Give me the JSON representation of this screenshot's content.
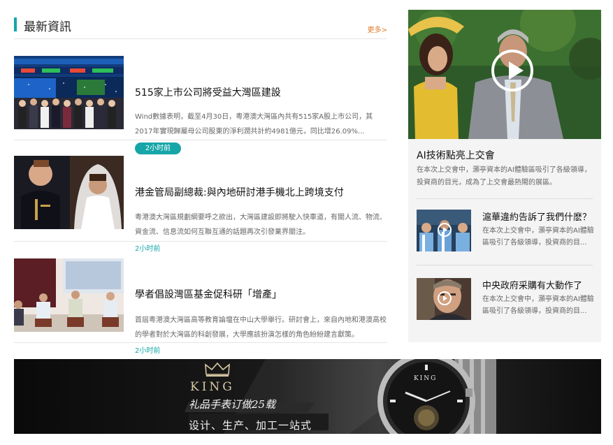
{
  "news": {
    "section_title": "最新資訊",
    "more_link": "更多>",
    "items": [
      {
        "headline": "515家上市公司將受益大灣區建設",
        "summary": "Wind數據表明，截至4月30日，粵港澳大灣區內共有515家A股上市公司，其2017年實現歸屬母公司股東的淨利潤共計約4981億元，同比增26.09%...",
        "time": "2小时前"
      },
      {
        "headline": "港金管局副總裁:與內地研討港手機北上跨境支付",
        "summary": "粵港澳大灣區規劃綱要呼之欲出，大灣區建設即將駛入快車道，有關人流、物流、資金流、信息流如何互聯互通的話題再次引發業界關注。",
        "time": "2小时前"
      },
      {
        "headline": "學者倡設灣區基金促科研「增產」",
        "summary": "首屆粵港澳大灣區高等教育論壇在中山大學舉行。研討會上，來自內地和港澳高校的學者對於大灣區的科創發展，大學應該扮演怎樣的角色紛紛建言獻策。",
        "time": "2小时前"
      }
    ]
  },
  "feature": {
    "title": "AI技術點亮上交會",
    "description": "在本次上交會中，灝亭資本的AI體驗區吸引了各級領導，投資商的目光，成為了上交會最熱閙的展區。",
    "videos": [
      {
        "title": "滬華違約告訴了我們什麽？",
        "description": "在本次上交會中，灝亭資本的AI體驗區吸引了各級領導，投資商的目..."
      },
      {
        "title": "中央政府采購有大動作了",
        "description": "在本次上交會中，灝亭資本的AI體驗區吸引了各級領導，投資商的目..."
      }
    ]
  },
  "ad": {
    "brand": "KING",
    "tagline_1": "礼品手表订做25载",
    "tagline_2": "设计、生产、加工一站式",
    "watch_brand": "KING"
  },
  "colors": {
    "accent": "#16a6a8",
    "more_link": "#e07b2a"
  },
  "icons": {
    "play": "play-circle-icon",
    "crown": "crown-icon"
  }
}
